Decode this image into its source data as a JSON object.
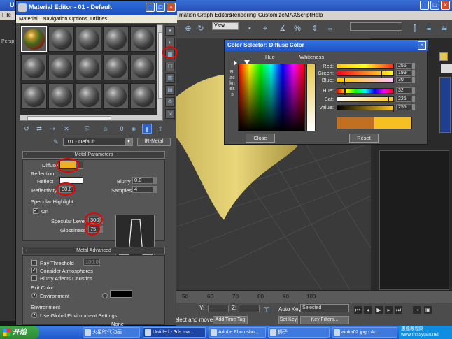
{
  "max": {
    "title": "Un",
    "menu": [
      "File",
      "mation",
      "Graph Editors",
      "Rendering",
      "Customize",
      "MAXScript",
      "Help"
    ],
    "view_dropdown": "View",
    "viewport_label": "Persp",
    "timeline_ticks": [
      "50",
      "60",
      "70",
      "80",
      "90",
      "100"
    ],
    "y_label": "Y:",
    "z_label": "Z:",
    "auto_key": "Auto Key",
    "selected": "Selected",
    "set_key": "Set Key",
    "key_filters": "Key Filters...",
    "status_left": "elect and move",
    "add_time_tag": "Add Time Tag"
  },
  "editor": {
    "title": "Material Editor - 01 - Default",
    "menu": [
      "Material",
      "Navigation",
      "Options",
      "Utilities"
    ],
    "material_name": "01 - Default",
    "material_type": "fR-Metal",
    "metal_parameters": {
      "header": "Metal Parameters",
      "diffuse_label": "Diffuse",
      "diffuse_color": "#f0b020",
      "reflection_group": "Reflection",
      "reflect_label": "Reflect",
      "blurry_label": "Blurry",
      "blurry_value": "0.0",
      "reflectivity_label": "Reflectivity",
      "reflectivity_value": "80.0",
      "samples_label": "Samples",
      "samples_value": "4",
      "specular_group": "Specular Highlight",
      "on_label": "On",
      "specular_level_label": "Specular Level",
      "specular_level_value": "300",
      "glossiness_label": "Glossiness",
      "glossiness_value": "75"
    },
    "metal_advanced": {
      "header": "Metal Advanced",
      "ray_threshold_label": "Ray Threshold",
      "ray_threshold_value": "100.0",
      "consider_atmospheres": "Consider Atmospheres",
      "blurry_affects_caustics": "Blurry Affects Caustics",
      "exit_color_group": "Exit Color",
      "environment_radio": "Environment",
      "environment_group": "Environment",
      "use_global_env": "Use Global Environment Settings",
      "none_label": "None"
    }
  },
  "color_selector": {
    "title": "Color Selector: Diffuse Color",
    "hue_label": "Hue",
    "whiteness_label": "Whiteness",
    "blackness_label": "Blackness",
    "sliders": [
      {
        "label": "Red:",
        "value": "255"
      },
      {
        "label": "Green:",
        "value": "199"
      },
      {
        "label": "Blue:",
        "value": "30"
      },
      {
        "label": "Hue:",
        "value": "32"
      },
      {
        "label": "Sat:",
        "value": "225"
      },
      {
        "label": "Value:",
        "value": "255"
      }
    ],
    "old_color": "#c07020",
    "new_color": "#f6c020",
    "close_button": "Close",
    "reset_button": "Reset"
  },
  "taskbar": {
    "start": "开始",
    "tasks": [
      "火星时代动画...",
      "Untitled - 3ds ma...",
      "Adobe Photosho...",
      "狮子",
      "aioka02.jpg - Ac..."
    ],
    "tray_text": "思缘教程网 www.missyuan.net"
  }
}
